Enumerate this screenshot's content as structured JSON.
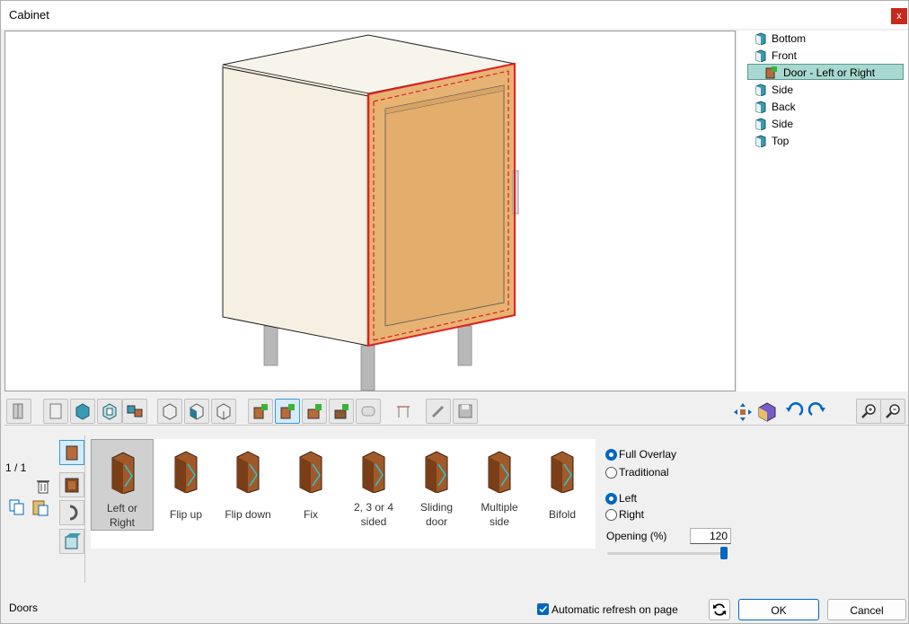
{
  "window": {
    "title": "Cabinet",
    "close_label": "x"
  },
  "tree": {
    "items": [
      {
        "label": "Bottom",
        "icon": "panel-icon",
        "selected": false
      },
      {
        "label": "Front",
        "icon": "panel-icon",
        "selected": false
      },
      {
        "label": "Door - Left or Right",
        "icon": "door-icon",
        "selected": true
      },
      {
        "label": "Side",
        "icon": "panel-icon",
        "selected": false
      },
      {
        "label": "Back",
        "icon": "panel-icon",
        "selected": false
      },
      {
        "label": "Side",
        "icon": "panel-icon",
        "selected": false
      },
      {
        "label": "Top",
        "icon": "panel-icon",
        "selected": false
      }
    ]
  },
  "page_counter": "1 / 1",
  "door_types": [
    {
      "label_lines": [
        "Left or",
        "Right"
      ],
      "selected": true
    },
    {
      "label_lines": [
        "Flip up"
      ],
      "selected": false
    },
    {
      "label_lines": [
        "Flip down"
      ],
      "selected": false
    },
    {
      "label_lines": [
        "Fix"
      ],
      "selected": false
    },
    {
      "label_lines": [
        "2, 3 or 4",
        "sided"
      ],
      "selected": false
    },
    {
      "label_lines": [
        "Sliding",
        "door"
      ],
      "selected": false
    },
    {
      "label_lines": [
        "Multiple",
        "side"
      ],
      "selected": false
    },
    {
      "label_lines": [
        "Bifold"
      ],
      "selected": false
    }
  ],
  "overlay": {
    "full_overlay": "Full Overlay",
    "traditional": "Traditional",
    "selected": "full_overlay"
  },
  "hinge_side": {
    "left": "Left",
    "right": "Right",
    "selected": "left"
  },
  "opening": {
    "label": "Opening (%)",
    "value": "120",
    "slider_fraction": 0.97
  },
  "status_text": "Doors",
  "auto_refresh": {
    "label": "Automatic refresh on page",
    "checked": true
  },
  "buttons": {
    "ok": "OK",
    "cancel": "Cancel"
  },
  "colors": {
    "accent": "#0067c0",
    "selection": "#a8d8cf",
    "wood": "#e8b575",
    "carcass": "#f6f2e6",
    "highlight": "#e02020"
  }
}
